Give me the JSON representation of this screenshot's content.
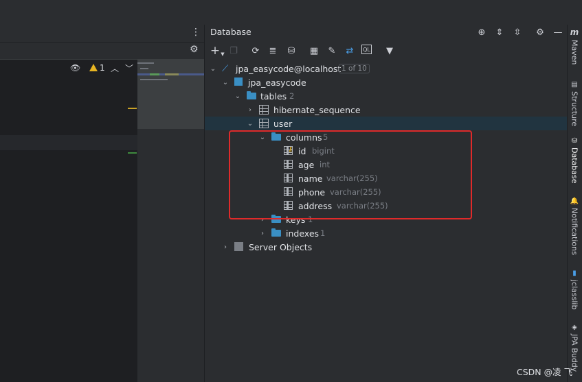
{
  "editor": {
    "warning_count": "1"
  },
  "database_panel": {
    "title": "Database"
  },
  "tree": {
    "connection": {
      "label": "jpa_easycode@localhost",
      "badge": "1 of 10"
    },
    "schema": {
      "label": "jpa_easycode"
    },
    "tables": {
      "label": "tables",
      "count": "2"
    },
    "table_hibernate": {
      "label": "hibernate_sequence"
    },
    "table_user": {
      "label": "user"
    },
    "columns": {
      "label": "columns",
      "count": "5"
    },
    "column_list": [
      {
        "name": "id",
        "type": "bigint"
      },
      {
        "name": "age",
        "type": "int"
      },
      {
        "name": "name",
        "type": "varchar(255)"
      },
      {
        "name": "phone",
        "type": "varchar(255)"
      },
      {
        "name": "address",
        "type": "varchar(255)"
      }
    ],
    "keys": {
      "label": "keys",
      "count": "1"
    },
    "indexes": {
      "label": "indexes",
      "count": "1"
    },
    "server_objects": {
      "label": "Server Objects"
    }
  },
  "right_strip": {
    "maven": "Maven",
    "structure": "Structure",
    "database": "Database",
    "notifications": "Notifications",
    "jclasslib": "jclasslib",
    "jpa_buddy": "JPA Buddy"
  },
  "watermark": "CSDN @凌 飞",
  "colors": {
    "background": "#2b2d30",
    "editor_bg": "#1e1f22",
    "selection": "#213440",
    "folder": "#3a8fc4",
    "highlight_border": "#e02a2a",
    "key_icon": "#e6b422"
  }
}
